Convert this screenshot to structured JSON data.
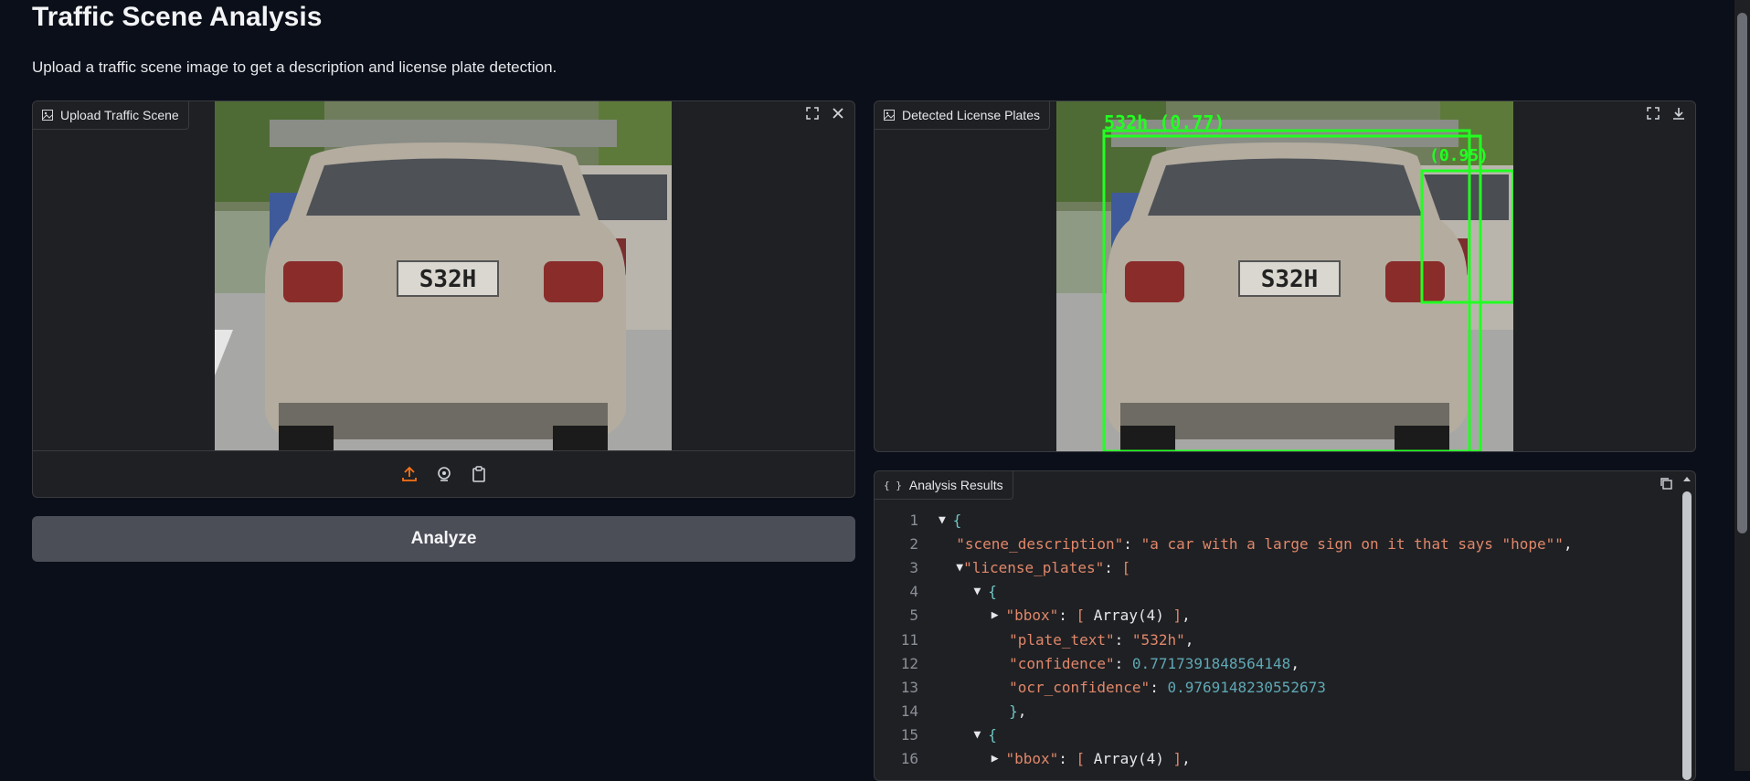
{
  "page": {
    "title": "Traffic Scene Analysis",
    "subtitle": "Upload a traffic scene image to get a description and license plate detection."
  },
  "input_panel": {
    "label": "Upload Traffic Scene",
    "plate_text": "S32H",
    "tools": [
      "fullscreen-icon",
      "close-icon"
    ],
    "sources": [
      "upload-icon",
      "webcam-icon",
      "clipboard-icon"
    ]
  },
  "output_panel": {
    "label": "Detected License Plates",
    "plate_text": "S32H",
    "detection_1_label": "532h (0.77)",
    "detection_2_label": "(0.95)",
    "tools": [
      "fullscreen-icon",
      "download-icon"
    ]
  },
  "analyze_button": {
    "label": "Analyze"
  },
  "results": {
    "label": "Analysis Results",
    "lines": [
      {
        "n": "1"
      },
      {
        "n": "2"
      },
      {
        "n": "3"
      },
      {
        "n": "4"
      },
      {
        "n": "5"
      },
      {
        "n": "11"
      },
      {
        "n": "12"
      },
      {
        "n": "13"
      },
      {
        "n": "14"
      },
      {
        "n": "15"
      },
      {
        "n": "16"
      }
    ],
    "scene_description_key": "\"scene_description\"",
    "scene_description_value": "\"a car with a large sign on it that says \"hope\"\"",
    "license_plates_key": "\"license_plates\"",
    "bbox_key": "\"bbox\"",
    "array_label": "Array(4)",
    "plate_text_key": "\"plate_text\"",
    "plate_text_value": "\"532h\"",
    "confidence_key": "\"confidence\"",
    "confidence_value": "0.7717391848564148",
    "ocr_confidence_key": "\"ocr_confidence\"",
    "ocr_confidence_value": "0.9769148230552673"
  },
  "colors": {
    "background": "#0b0f19",
    "panel": "#1f2023",
    "accent_upload": "#f97316",
    "detection_box": "#22ff22",
    "json_key": "#e0876a",
    "json_number": "#5fa8b5"
  }
}
